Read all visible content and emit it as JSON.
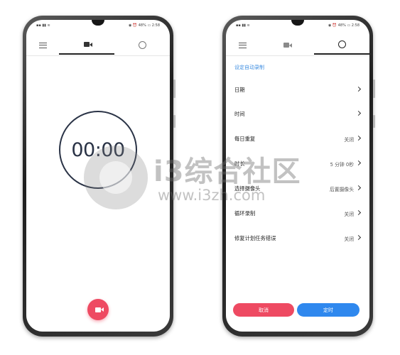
{
  "left_phone": {
    "status_left": "▪▪ ▮▮ ≋",
    "status_right": "◉ ⏰ 48% ▭ 2:58",
    "tabs": [
      {
        "icon": "menu-icon",
        "active": false
      },
      {
        "icon": "video-icon",
        "active": true
      },
      {
        "icon": "alarm-icon",
        "active": false
      }
    ],
    "timer": "00:00",
    "record_button_icon": "video-icon"
  },
  "right_phone": {
    "status_left": "▪▪ ▮▮ ≋",
    "status_right": "◉ ⏰ 48% ▭ 2:58",
    "tabs": [
      {
        "icon": "menu-icon",
        "active": false
      },
      {
        "icon": "video-icon",
        "active": false
      },
      {
        "icon": "alarm-icon",
        "active": true
      }
    ],
    "section_title": "设定自动录制",
    "settings": [
      {
        "label": "日期",
        "value": ""
      },
      {
        "label": "时间",
        "value": ""
      },
      {
        "label": "每日重复",
        "value": "关闭"
      },
      {
        "label": "时长",
        "value": "5 分钟 0秒"
      },
      {
        "label": "选择摄像头",
        "value": "后置摄像头"
      },
      {
        "label": "循环录制",
        "value": "关闭"
      },
      {
        "label": "修复计划任务错误",
        "value": "关闭"
      }
    ],
    "cancel_label": "取消",
    "confirm_label": "定时"
  },
  "watermark": {
    "text": "i3综合社区",
    "url": "www.i3zh.com"
  },
  "colors": {
    "accent_red": "#ee4a62",
    "accent_blue": "#2f88ee",
    "section_blue": "#3d8de0",
    "timer_dark": "#2a3346"
  }
}
